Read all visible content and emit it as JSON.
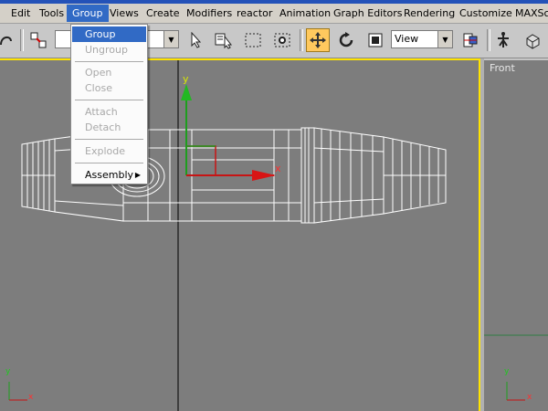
{
  "menubar": {
    "items": [
      "Edit",
      "Tools",
      "Group",
      "Views",
      "Create",
      "Modifiers",
      "reactor",
      "Animation",
      "Graph Editors",
      "Rendering",
      "Customize",
      "MAXScri"
    ],
    "active": "Group"
  },
  "toolbar": {
    "view_combo": "View",
    "icons": [
      "unlink-icon",
      "bind-icon",
      "select-filter-combo",
      "select-arrow-icon",
      "select-by-name-icon",
      "region-select-icon",
      "window-crossing-icon",
      "move-icon",
      "rotate-icon",
      "scale-icon",
      "reference-coordinate-combo",
      "pivot-center-icon",
      "select-manipulate-icon",
      "render-teapot-icon"
    ]
  },
  "group_menu": {
    "items": [
      {
        "label": "Group",
        "state": "highlighted"
      },
      {
        "label": "Ungroup",
        "state": "disabled"
      },
      {
        "label": "Open",
        "state": "disabled"
      },
      {
        "label": "Close",
        "state": "disabled"
      },
      {
        "label": "Attach",
        "state": "disabled"
      },
      {
        "label": "Detach",
        "state": "disabled"
      },
      {
        "label": "Explode",
        "state": "disabled"
      },
      {
        "label": "Assembly",
        "state": "enabled",
        "submenu": true
      }
    ]
  },
  "viewports": {
    "top_axes": {
      "y": "y",
      "x": "x"
    },
    "front_label": "Front",
    "corner_axes": {
      "y": "y",
      "x": "x"
    }
  },
  "colors": {
    "viewport_bg": "#7d7d7d",
    "active_border": "#ffe400",
    "highlight": "#316ac5",
    "wireframe": "#ffffff"
  }
}
